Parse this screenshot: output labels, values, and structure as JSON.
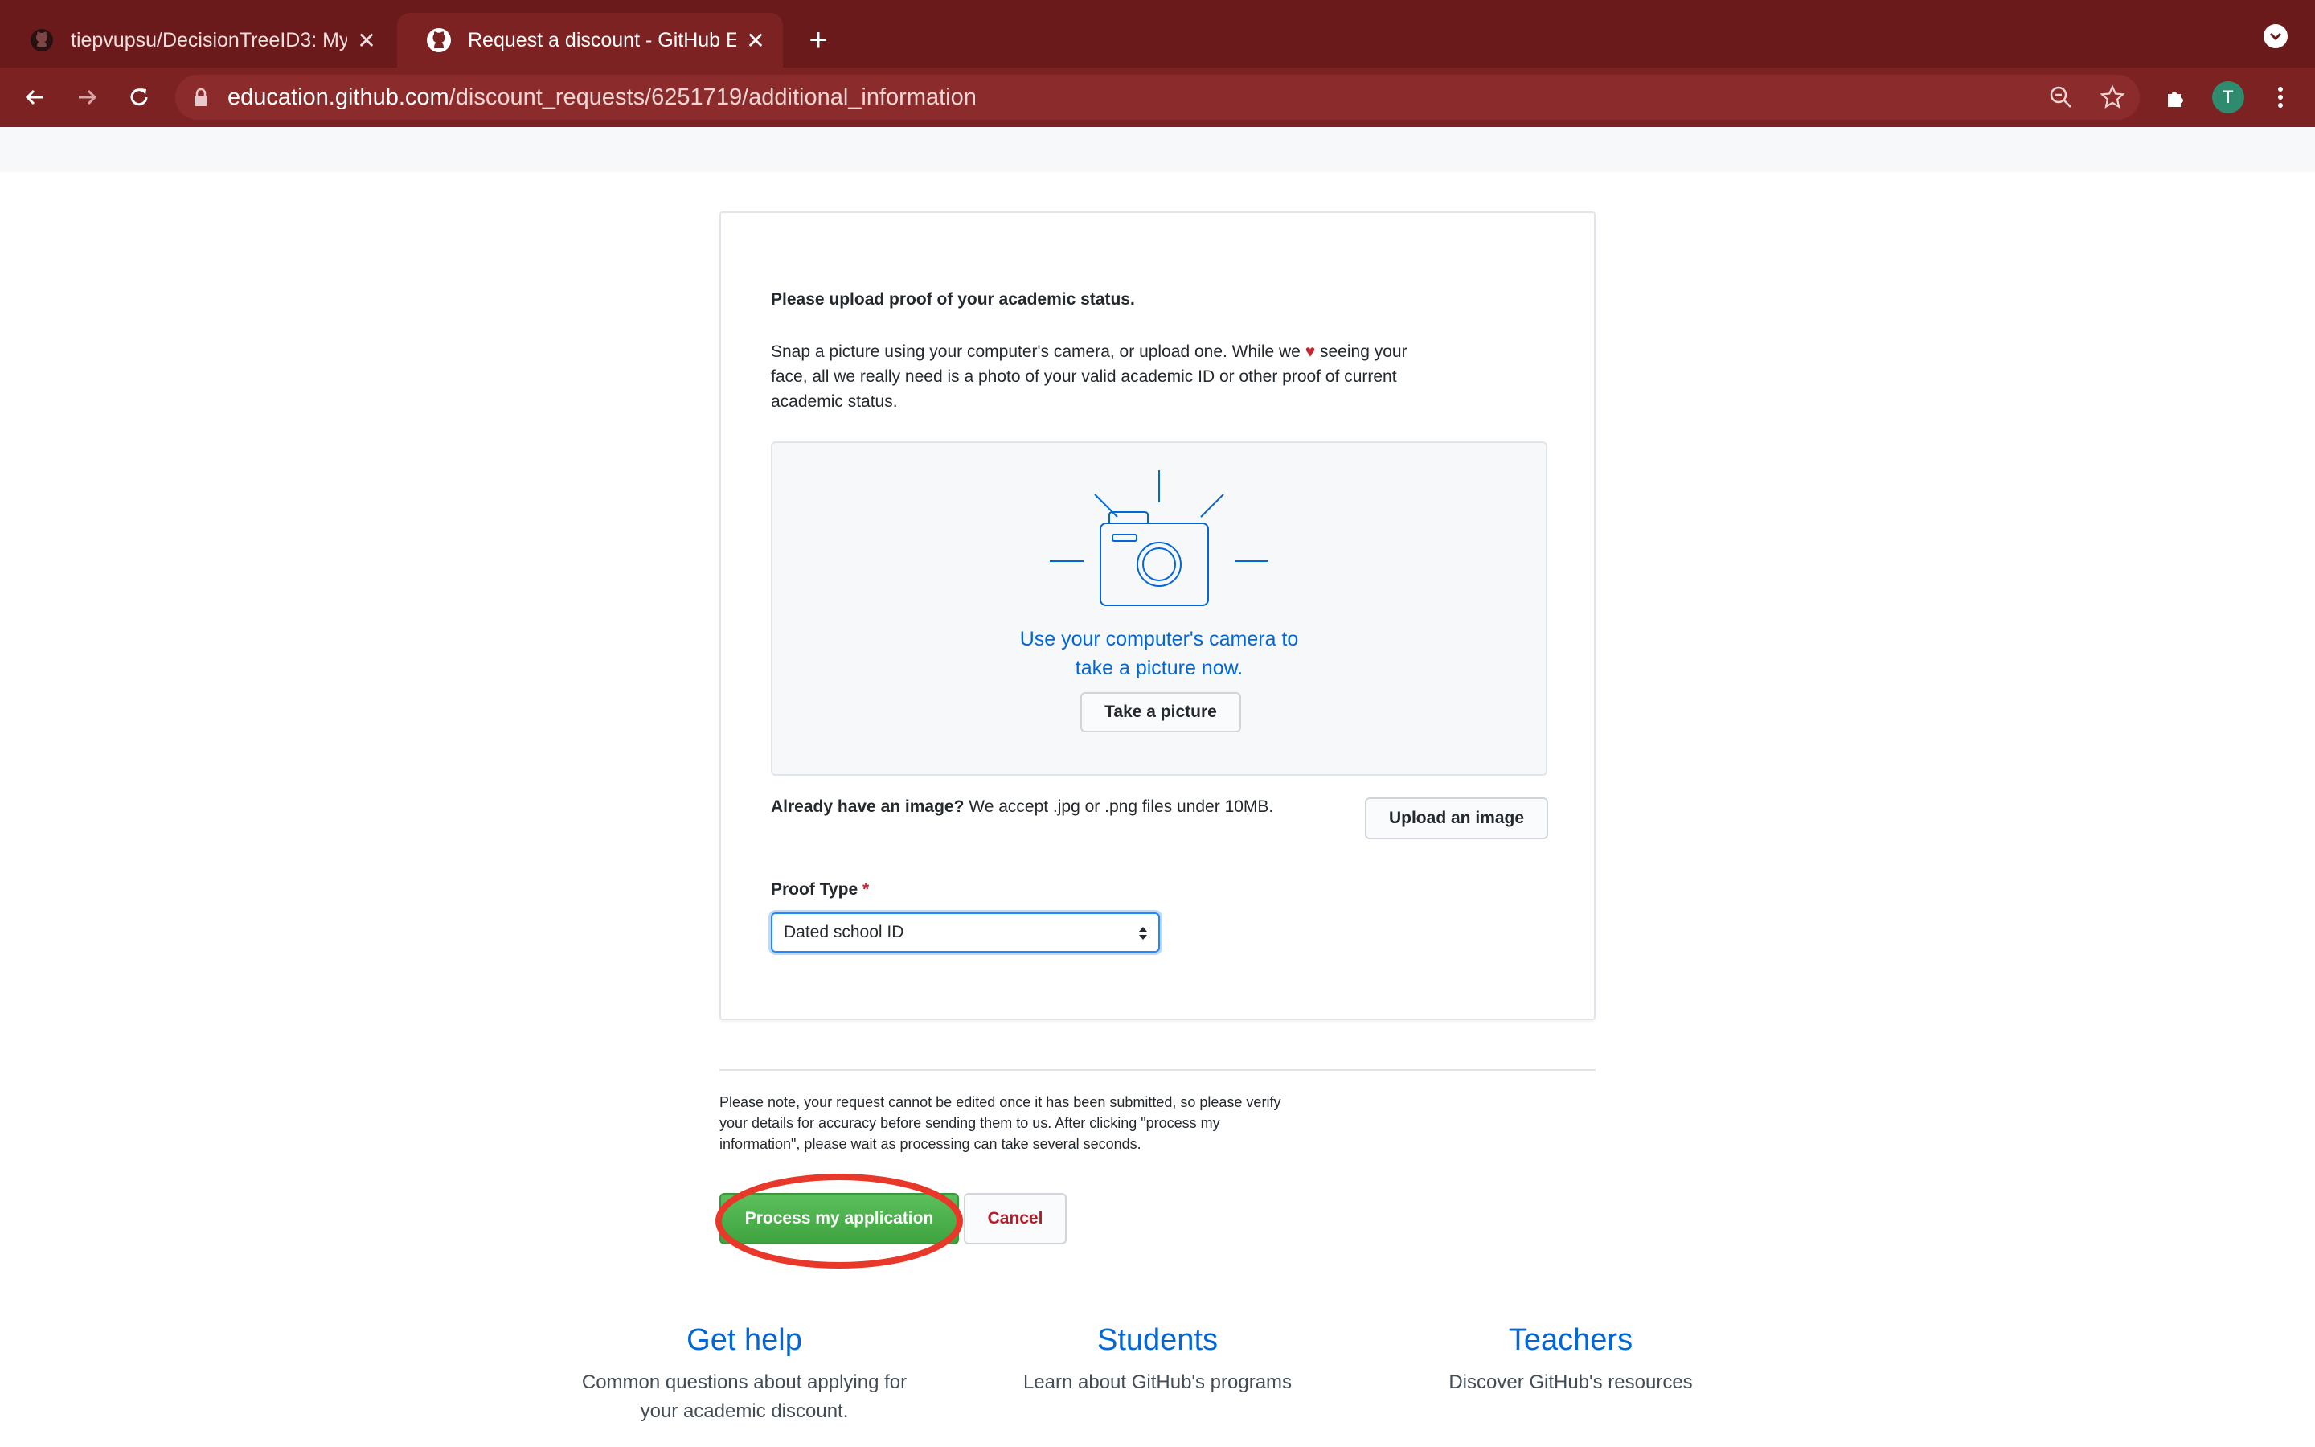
{
  "browser": {
    "tabs": [
      {
        "title": "tiepvupsu/DecisionTreeID3: My",
        "close": "✕"
      },
      {
        "title": "Request a discount - GitHub Ed",
        "close": "✕"
      }
    ],
    "new_tab": "+",
    "url_host": "education.github.com",
    "url_path": "/discount_requests/6251719/additional_information",
    "avatar_letter": "T",
    "icons": [
      "back-icon",
      "forward-icon",
      "reload-icon",
      "lock-icon",
      "zoom-icon",
      "star-icon",
      "extensions-icon",
      "kebab-menu-icon"
    ]
  },
  "card": {
    "heading": "Please upload proof of your academic status.",
    "desc_before_heart": "Snap a picture using your computer's camera, or upload one. While we ",
    "heart": "♥",
    "desc_after_heart": " seeing your face, all we really need is a photo of your valid academic ID or other proof of current academic status.",
    "camera_line1": "Use your computer's camera to",
    "camera_line2": "take a picture now.",
    "take_picture": "Take a picture",
    "already_bold": "Already have an image?",
    "already_text": " We accept .jpg or .png files under 10MB.",
    "upload_button": "Upload an image",
    "proof_label": "Proof Type",
    "required_mark": "*",
    "proof_selected": "Dated school ID"
  },
  "submit": {
    "note": "Please note, your request cannot be edited once it has been submitted, so please verify your details for accuracy before sending them to us. After clicking \"process my information\", please wait as processing can take several seconds.",
    "process_button": "Process my application",
    "cancel_button": "Cancel"
  },
  "footer": [
    {
      "title": "Get help",
      "text": "Common questions about applying for your academic discount."
    },
    {
      "title": "Students",
      "text": "Learn about GitHub's programs"
    },
    {
      "title": "Teachers",
      "text": "Discover GitHub's resources"
    }
  ],
  "colors": {
    "chrome_tab_bar": "#6a1a1a",
    "chrome_toolbar": "#7d2222",
    "link_blue": "#0366d6",
    "primary_green": "#4caf50",
    "highlight_ring": "#e8382a"
  }
}
